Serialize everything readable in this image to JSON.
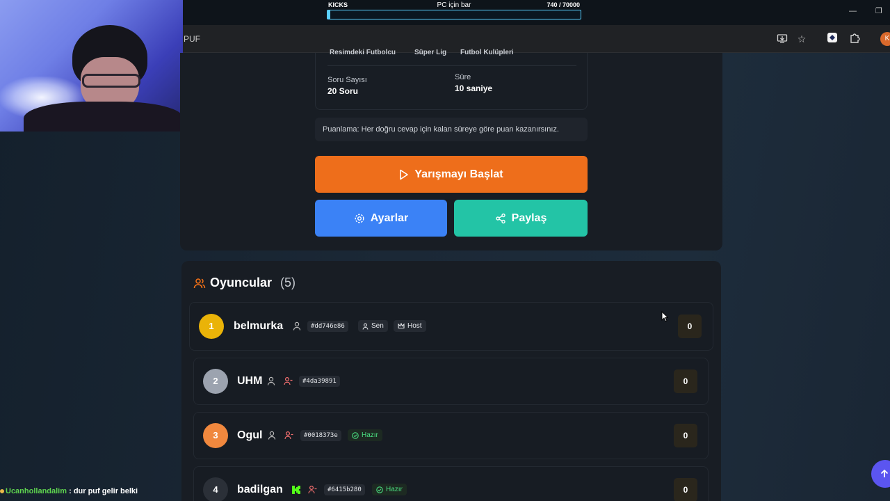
{
  "overlay": {
    "kicks_label": "KICKS",
    "bar_title": "PC için bar",
    "count_text": "740 / 70000",
    "progress_fraction": 0.0106
  },
  "browser": {
    "url_fragment": "PUF",
    "profile_initial": "K"
  },
  "quiz": {
    "chips": [
      "Resimdeki Futbolcu",
      "Süper Lig",
      "Futbol Kulüpleri"
    ],
    "question_count_label": "Soru Sayısı",
    "question_count_value": "20 Soru",
    "duration_label": "Süre",
    "duration_value": "10 saniye",
    "scoring_note": "Puanlama: Her doğru cevap için kalan süreye göre puan kazanırsınız.",
    "start_label": "Yarışmayı Başlat",
    "settings_label": "Ayarlar",
    "share_label": "Paylaş"
  },
  "players": {
    "title": "Oyuncular",
    "count": "(5)",
    "list": [
      {
        "rank": "1",
        "name": "belmurka",
        "tag": "#dd746e86",
        "you": "Sen",
        "host": "Host",
        "score": "0",
        "rank_color": "#eab308"
      },
      {
        "rank": "2",
        "name": "UHM",
        "tag": "#4da39891",
        "score": "0",
        "rank_color": "#9ca3af"
      },
      {
        "rank": "3",
        "name": "Ogul",
        "tag": "#0018373e",
        "status": "Hazır",
        "score": "0",
        "rank_color": "#f0883e"
      },
      {
        "rank": "4",
        "name": "badilgan",
        "tag": "#6415b280",
        "status": "Hazır",
        "score": "0",
        "rank_color": "#2b3038"
      }
    ]
  },
  "chat": {
    "user": "Ucanhollandalim",
    "separator": " : ",
    "message": "dur puf gelir belki"
  }
}
